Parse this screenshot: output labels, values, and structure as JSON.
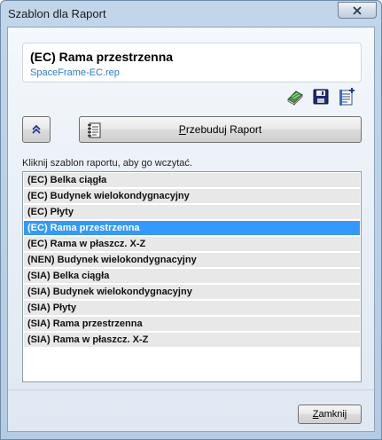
{
  "window": {
    "title": "Szablon dla Raport"
  },
  "header": {
    "title": "(EC) Rama przestrzenna",
    "file": "SpaceFrame-EC.rep"
  },
  "toolbar": {
    "icons": [
      "book-icon",
      "save-icon",
      "add-notes-icon"
    ]
  },
  "actions": {
    "rebuild_label": "Przebuduj Raport",
    "close_label": "Zamknij"
  },
  "hint": "Kliknij szablon raportu, aby go wczytać.",
  "templates": {
    "items": [
      "(EC) Belka ciągła",
      "(EC) Budynek wielokondygnacyjny",
      "(EC) Płyty",
      "(EC) Rama przestrzenna",
      "(EC) Rama w płaszcz. X-Z",
      "(NEN) Budynek wielokondygnacyjny",
      "(SIA) Belka ciągła",
      "(SIA) Budynek wielokondygnacyjny",
      "(SIA) Płyty",
      "(SIA) Rama przestrzenna",
      "(SIA) Rama w płaszcz. X-Z"
    ],
    "selected_index": 3
  },
  "colors": {
    "selection": "#3399ff",
    "file_link": "#2a7ccf"
  }
}
